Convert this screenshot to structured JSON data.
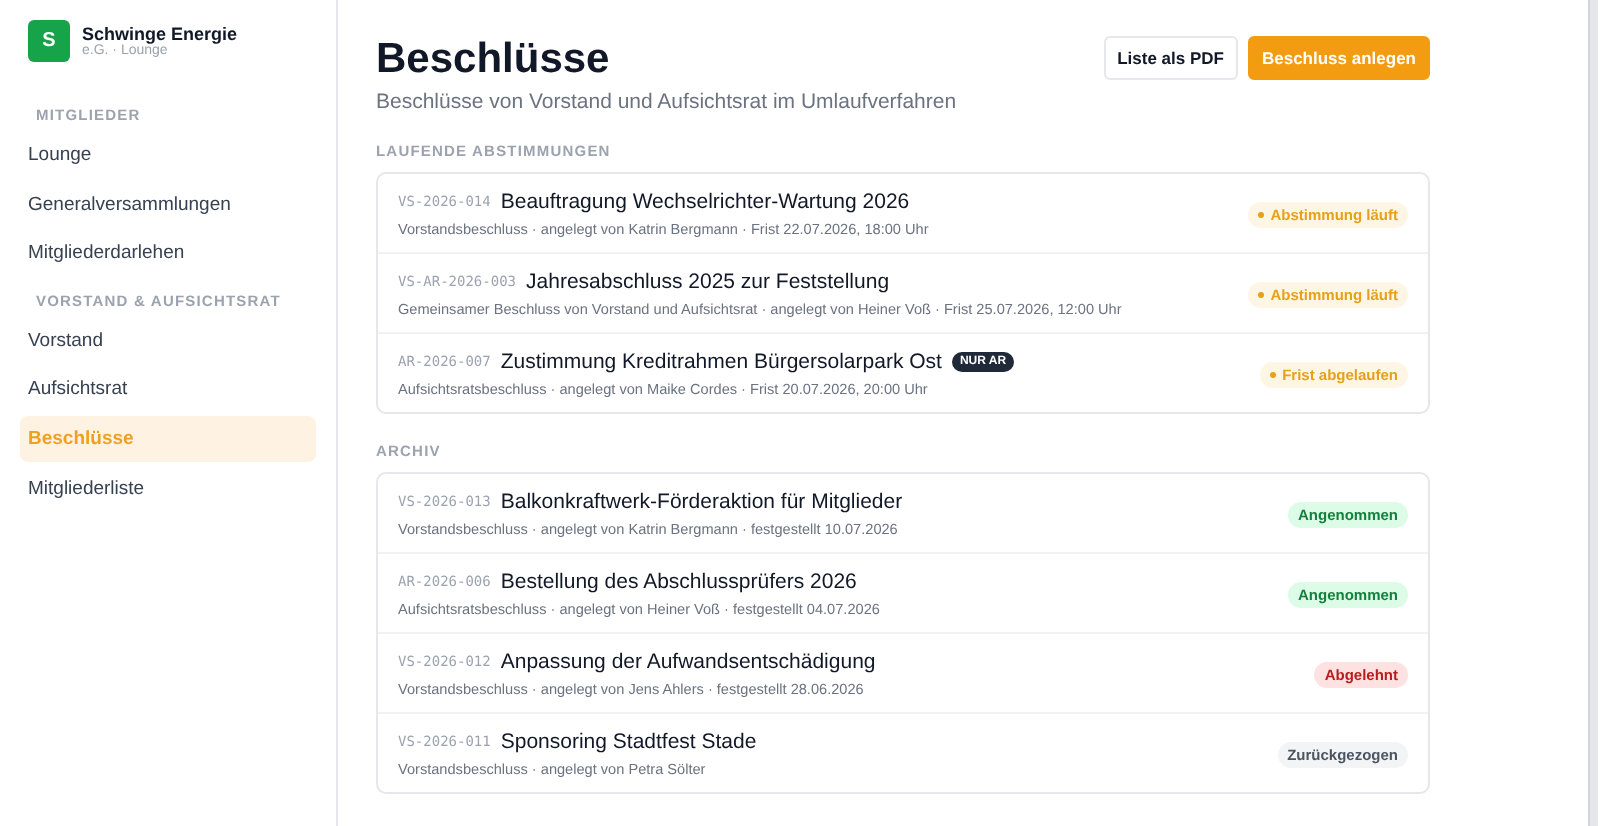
{
  "org": {
    "logo": "S",
    "name": "Schwinge Energie",
    "subtitle": "e.G. · Lounge"
  },
  "sidebar": {
    "sections": [
      {
        "heading": "MITGLIEDER",
        "items": [
          {
            "label": "Lounge",
            "selected": false
          },
          {
            "label": "Generalversammlungen",
            "selected": false
          },
          {
            "label": "Mitgliederdarlehen",
            "selected": false
          }
        ]
      },
      {
        "heading": "VORSTAND & AUFSICHTSRAT",
        "items": [
          {
            "label": "Vorstand",
            "selected": false
          },
          {
            "label": "Aufsichtsrat",
            "selected": false
          },
          {
            "label": "Beschlüsse",
            "selected": true
          },
          {
            "label": "Mitgliederliste",
            "selected": false
          }
        ]
      }
    ]
  },
  "page": {
    "title": "Beschlüsse",
    "subtitle": "Beschlüsse von Vorstand und Aufsichtsrat im Umlaufverfahren",
    "buttons": [
      {
        "label": "Liste als PDF",
        "kind": "secondary"
      },
      {
        "label": "Beschluss anlegen",
        "kind": "primary"
      }
    ]
  },
  "groups": [
    {
      "heading": "LAUFENDE ABSTIMMUNGEN",
      "items": [
        {
          "id": "VS-2026-014",
          "title": "Beauftragung Wechselrichter-Wartung 2026",
          "meta": "Vorstandsbeschluss · angelegt von Katrin Bergmann · Frist 22.07.2026, 18:00 Uhr",
          "status": {
            "kind": "running",
            "label": "Abstimmung läuft"
          }
        },
        {
          "id": "VS-AR-2026-003",
          "title": "Jahresabschluss 2025 zur Feststellung",
          "meta": "Gemeinsamer Beschluss von Vorstand und Aufsichtsrat · angelegt von Heiner Voß · Frist 25.07.2026, 12:00 Uhr",
          "status": {
            "kind": "running",
            "label": "Abstimmung läuft"
          }
        },
        {
          "id": "AR-2026-007",
          "title": "Zustimmung Kreditrahmen Bürgersolarpark Ost",
          "tag": "NUR AR",
          "meta": "Aufsichtsratsbeschluss · angelegt von Maike Cordes · Frist 20.07.2026, 20:00 Uhr",
          "status": {
            "kind": "expired",
            "label": "Frist abgelaufen"
          }
        }
      ]
    },
    {
      "heading": "ARCHIV",
      "items": [
        {
          "id": "VS-2026-013",
          "title": "Balkonkraftwerk-Förderaktion für Mitglieder",
          "meta": "Vorstandsbeschluss · angelegt von Katrin Bergmann · festgestellt 10.07.2026",
          "status": {
            "kind": "accepted",
            "label": "Angenommen"
          }
        },
        {
          "id": "AR-2026-006",
          "title": "Bestellung des Abschlussprüfers 2026",
          "meta": "Aufsichtsratsbeschluss · angelegt von Heiner Voß · festgestellt 04.07.2026",
          "status": {
            "kind": "accepted",
            "label": "Angenommen"
          }
        },
        {
          "id": "VS-2026-012",
          "title": "Anpassung der Aufwandsentschädigung",
          "meta": "Vorstandsbeschluss · angelegt von Jens Ahlers · festgestellt 28.06.2026",
          "status": {
            "kind": "rejected",
            "label": "Abgelehnt"
          }
        },
        {
          "id": "VS-2026-011",
          "title": "Sponsoring Stadtfest Stade",
          "meta": "Vorstandsbeschluss · angelegt von Petra Sölter",
          "status": {
            "kind": "withdrawn",
            "label": "Zurückgezogen"
          }
        }
      ]
    }
  ]
}
